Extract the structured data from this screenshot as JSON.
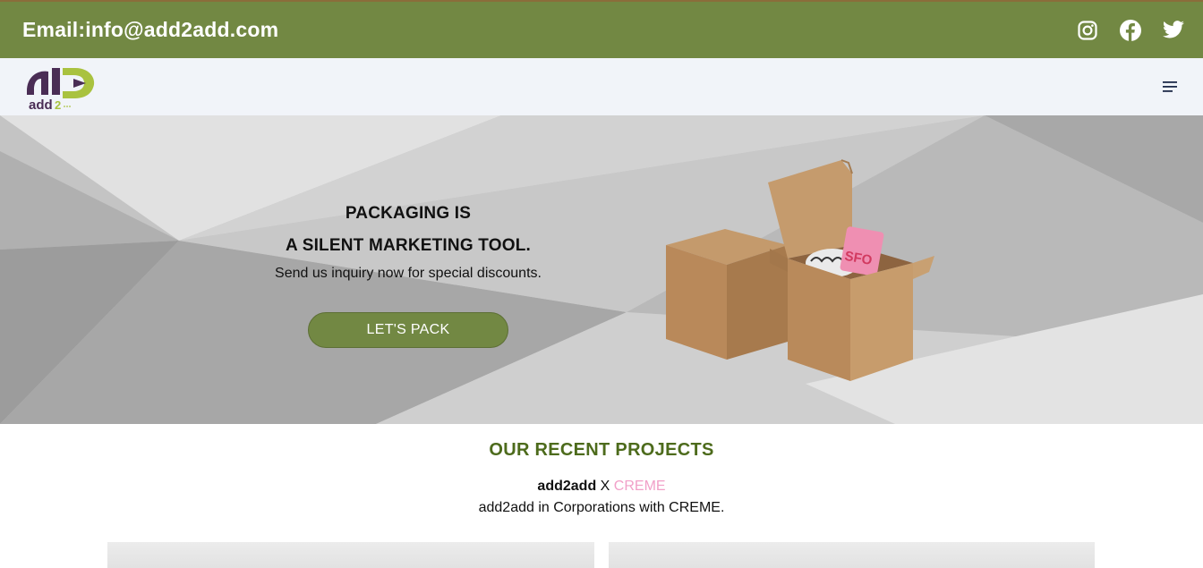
{
  "topbar": {
    "email": "Email:info@add2add.com",
    "socials": [
      "instagram-icon",
      "facebook-icon",
      "twitter-icon"
    ]
  },
  "navbar": {
    "logo_text": "add2",
    "menu_icon": "hamburger-menu-icon"
  },
  "hero": {
    "title_line1": "PACKAGING IS",
    "title_line2": "A SILENT MARKETING TOOL.",
    "subtitle": "Send us inquiry now for special discounts.",
    "cta_label": "LET'S PACK",
    "tag_text": "SFO"
  },
  "projects": {
    "title": "OUR RECENT PROJECTS",
    "brand": "add2add",
    "separator": "X",
    "partner": "CREME",
    "description": "add2add in Corporations with CREME."
  },
  "colors": {
    "brand_green": "#728843",
    "title_green": "#4d6b1c",
    "partner_pink": "#f1a0c8",
    "logo_purple": "#4a2d55",
    "logo_lime": "#a9c23f"
  }
}
